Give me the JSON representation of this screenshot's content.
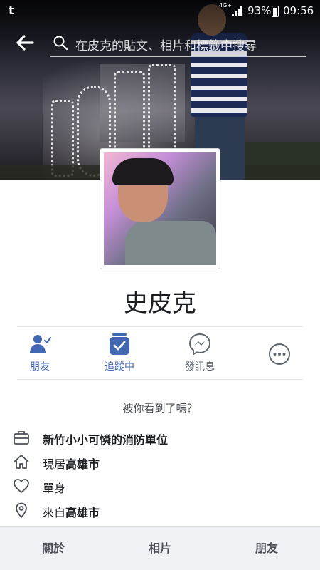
{
  "status_bar": {
    "app_glyph": "t",
    "network": "4G+",
    "battery": "93%",
    "time": "09:56"
  },
  "header": {
    "search_placeholder": "在皮克的貼文、相片和標籤中搜尋"
  },
  "profile": {
    "name": "史皮克"
  },
  "actions": [
    {
      "label": "朋友",
      "icon": "friends-check-icon"
    },
    {
      "label": "追蹤中",
      "icon": "following-icon"
    },
    {
      "label": "發訊息",
      "icon": "messenger-icon"
    },
    {
      "label": "",
      "icon": "more-icon"
    }
  ],
  "seen_prompt": "被你看到了嗎？",
  "info": {
    "work": "新竹小小可憐的消防單位",
    "lives_prefix": "現居",
    "lives_city": "高雄市",
    "relationship": "單身",
    "from_prefix": "來自",
    "from_city": "高雄市"
  },
  "tabs": [
    {
      "label": "關於"
    },
    {
      "label": "相片"
    },
    {
      "label": "朋友"
    }
  ],
  "colors": {
    "accent": "#4267b2",
    "text_secondary": "#606770"
  }
}
